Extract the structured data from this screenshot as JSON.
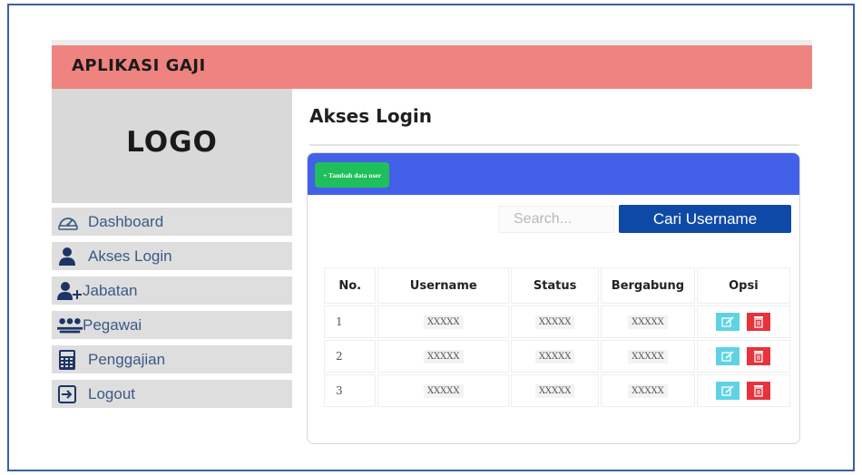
{
  "app": {
    "title": "APLIKASI GAJI"
  },
  "sidebar": {
    "logo": "LOGO",
    "items": [
      {
        "label": "Dashboard",
        "icon": "dashboard-gauge-icon"
      },
      {
        "label": "Akses Login",
        "icon": "user-icon"
      },
      {
        "label": "Jabatan",
        "icon": "user-plus-icon"
      },
      {
        "label": "Pegawai",
        "icon": "users-group-icon"
      },
      {
        "label": "Penggajian",
        "icon": "calculator-icon"
      },
      {
        "label": "Logout",
        "icon": "logout-icon"
      }
    ]
  },
  "main": {
    "title": "Akses Login",
    "add_button": "+ Tambah data user",
    "search": {
      "placeholder": "Search...",
      "button": "Cari Username"
    },
    "table": {
      "headers": [
        "No.",
        "Username",
        "Status",
        "Bergabung",
        "Opsi"
      ],
      "rows": [
        {
          "no": "1",
          "username": "XXXXX",
          "status": "XXXXX",
          "bergabung": "XXXXX"
        },
        {
          "no": "2",
          "username": "XXXXX",
          "status": "XXXXX",
          "bergabung": "XXXXX"
        },
        {
          "no": "3",
          "username": "XXXXX",
          "status": "XXXXX",
          "bergabung": "XXXXX"
        }
      ]
    }
  },
  "colors": {
    "header": "#ef837f",
    "card_header": "#4361e8",
    "add_button": "#1fbf5c",
    "search_button": "#0f49a7",
    "edit_button": "#5fd3e4",
    "delete_button": "#e8323c"
  }
}
